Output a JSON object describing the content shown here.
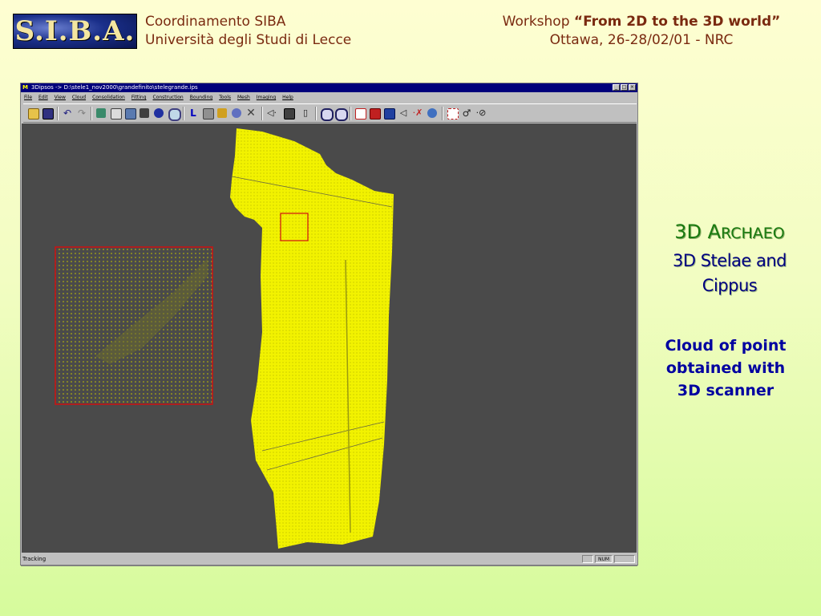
{
  "slide": {
    "logo_text": "S.I.B.A.",
    "header_left": {
      "line1": "Coordinamento SIBA",
      "line2": "Università degli Studi di Lecce"
    },
    "header_right": {
      "workshop_prefix": "Workshop ",
      "workshop_title": "“From 2D to the 3D world”",
      "line2": "Ottawa, 26-28/02/01 - NRC"
    },
    "right_panel": {
      "title_first": "3D A",
      "title_rest": "RCHAEO",
      "subtitle_line1": "3D Stelae and",
      "subtitle_line2": "Cippus",
      "note_line1": "Cloud of point",
      "note_line2": "obtained with",
      "note_line3": "3D scanner"
    }
  },
  "window": {
    "title_icon": "M",
    "title": "3Dipsos -> D:\\stele1_nov2000\\grandefinito\\stelegrande.ips",
    "controls": [
      "_",
      "□",
      "×"
    ],
    "menu": [
      "File",
      "Edit",
      "View",
      "Cloud",
      "Consolidation",
      "Fitting",
      "Construction",
      "Bounding",
      "Tools",
      "Mesh",
      "Imaging",
      "Help"
    ],
    "toolbar_icons": [
      "open-folder-icon",
      "save-icon",
      "undo-icon",
      "redo-icon",
      "cloud-points-icon",
      "print-icon",
      "image-icon",
      "camera-icon",
      "person-icon",
      "magnify-icon",
      "axes-icon",
      "lock-icon",
      "arrows-icon",
      "rotate-icon",
      "delete-icon",
      "point-tool-icon",
      "display-mode-icon",
      "ruler-icon",
      "zoom-in-icon",
      "zoom-out-icon",
      "erase-icon",
      "view-icon",
      "info-icon",
      "nav-left-icon",
      "spline-icon",
      "sync-icon",
      "select-region-icon",
      "settings-icon",
      "brush-icon"
    ],
    "status": {
      "text": "Tracking",
      "num_label": "NUM"
    },
    "colors": {
      "point_cloud": "#f2f200",
      "highlight_box": "#d01010",
      "viewport": "#4a4a4a"
    }
  }
}
